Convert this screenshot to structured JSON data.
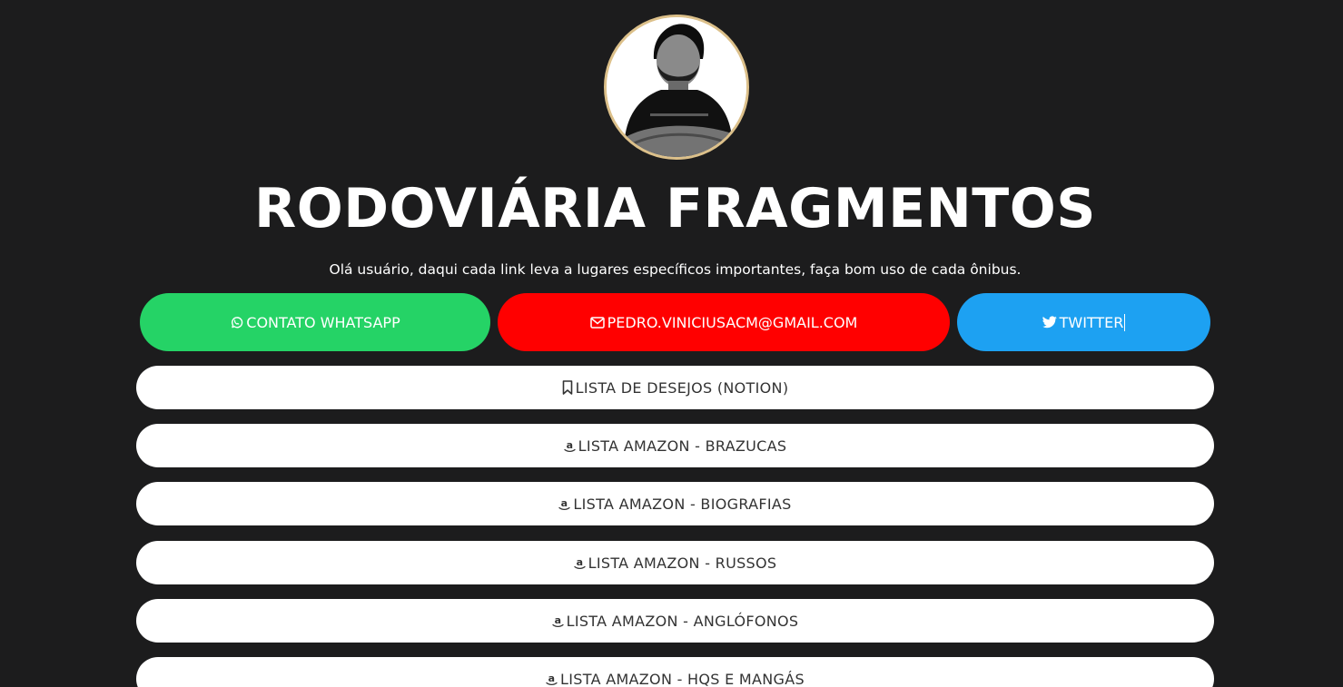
{
  "profile": {
    "title": "RODOVIÁRIA FRAGMENTOS",
    "subtitle": "Olá usuário, daqui cada link leva a lugares específicos importantes, faça bom uso de cada ônibus."
  },
  "social": [
    {
      "label": "CONTATO WHATSAPP",
      "icon": "whatsapp-icon",
      "color": "#25d366"
    },
    {
      "label": "PEDRO.VINICIUSACM@GMAIL.COM",
      "icon": "envelope-icon",
      "color": "#ff0000"
    },
    {
      "label": "TWITTER",
      "icon": "twitter-icon",
      "color": "#1da1f2"
    }
  ],
  "links": [
    {
      "label": "LISTA DE DESEJOS (NOTION)",
      "icon": "bookmark-icon"
    },
    {
      "label": "LISTA AMAZON - BRAZUCAS",
      "icon": "amazon-icon"
    },
    {
      "label": "LISTA AMAZON - BIOGRAFIAS",
      "icon": "amazon-icon"
    },
    {
      "label": "LISTA AMAZON - RUSSOS",
      "icon": "amazon-icon"
    },
    {
      "label": "LISTA AMAZON - ANGLÓFONOS",
      "icon": "amazon-icon"
    },
    {
      "label": "LISTA AMAZON - HQS E MANGÁS",
      "icon": "amazon-icon"
    }
  ],
  "colors": {
    "background": "#1c1c1d",
    "avatar_ring": "#dcc08a",
    "link_background": "#ffffff",
    "link_text": "#333333"
  }
}
